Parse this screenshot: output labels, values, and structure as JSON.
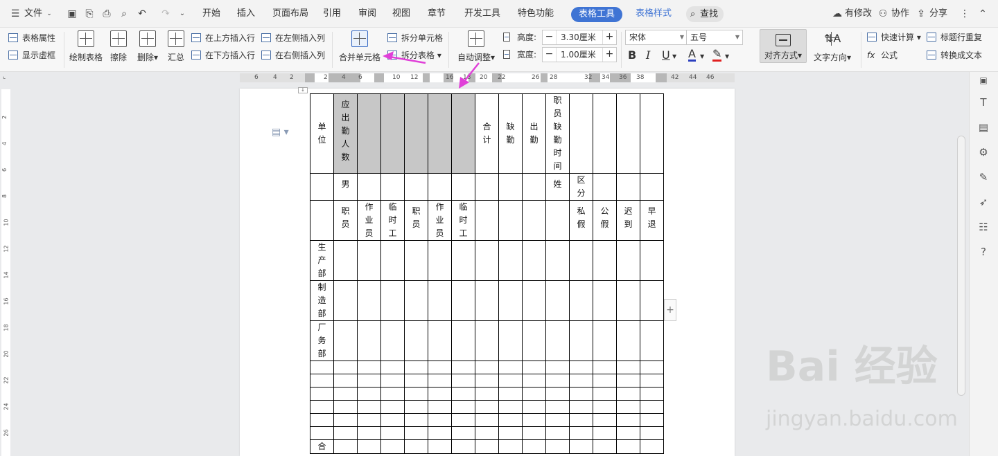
{
  "menubar": {
    "file_label": "文件",
    "tabs": [
      "开始",
      "插入",
      "页面布局",
      "引用",
      "审阅",
      "视图",
      "章节",
      "开发工具",
      "特色功能"
    ],
    "active_tab": "表格工具",
    "blue_tab": "表格样式",
    "search": "查找",
    "right": [
      "有修改",
      "协作",
      "分享"
    ]
  },
  "ribbon": {
    "table_props": "表格属性",
    "show_grid": "显示虚框",
    "draw_table": "绘制表格",
    "erase": "擦除",
    "delete": "删除",
    "summary": "汇总",
    "insert_above": "在上方插入行",
    "insert_below": "在下方插入行",
    "insert_left": "在左侧插入列",
    "insert_right": "在右侧插入列",
    "merge": "合并单元格",
    "split_cell": "拆分单元格",
    "split_table": "拆分表格",
    "auto_fit": "自动调整",
    "height_label": "高度:",
    "height_value": "3.30厘米",
    "width_label": "宽度:",
    "width_value": "1.00厘米",
    "font": "宋体",
    "size": "五号",
    "bold": "B",
    "italic": "I",
    "underline": "U",
    "align": "对齐方式",
    "text_dir": "文字方向",
    "quick_calc": "快速计算",
    "repeat_header": "标题行重复",
    "formula": "公式",
    "to_text": "转换成文本"
  },
  "ruler": {
    "h_numbers": [
      "6",
      "4",
      "2",
      "2",
      "4",
      "6",
      "10",
      "12",
      "16",
      "18",
      "20",
      "22",
      "26",
      "28",
      "32",
      "34",
      "36",
      "38",
      "42",
      "44",
      "46"
    ],
    "v_numbers": [
      "2",
      "4",
      "6",
      "8",
      "10",
      "12",
      "14",
      "16",
      "18",
      "20",
      "22",
      "24",
      "26"
    ]
  },
  "table": {
    "r1": [
      "单位",
      "应出勤人数",
      "",
      "",
      "",
      "",
      "",
      "合计",
      "缺勤",
      "出勤",
      "职员缺勤时间",
      "",
      "",
      "",
      ""
    ],
    "r2": [
      "",
      "男",
      "",
      "",
      "",
      "",
      "",
      "",
      "",
      "",
      "姓",
      "区分",
      "",
      "",
      ""
    ],
    "r3": [
      "",
      "职员",
      "作业员",
      "临时工",
      "职员",
      "作业员",
      "临时工",
      "",
      "",
      "",
      "",
      "私假",
      "公假",
      "迟到",
      "早退"
    ],
    "depts": [
      "生产部",
      "制造部",
      "厂务部"
    ],
    "last_cell": "合"
  },
  "watermark": {
    "main": "Bai 经验",
    "sub": "jingyan.baidu.com"
  }
}
